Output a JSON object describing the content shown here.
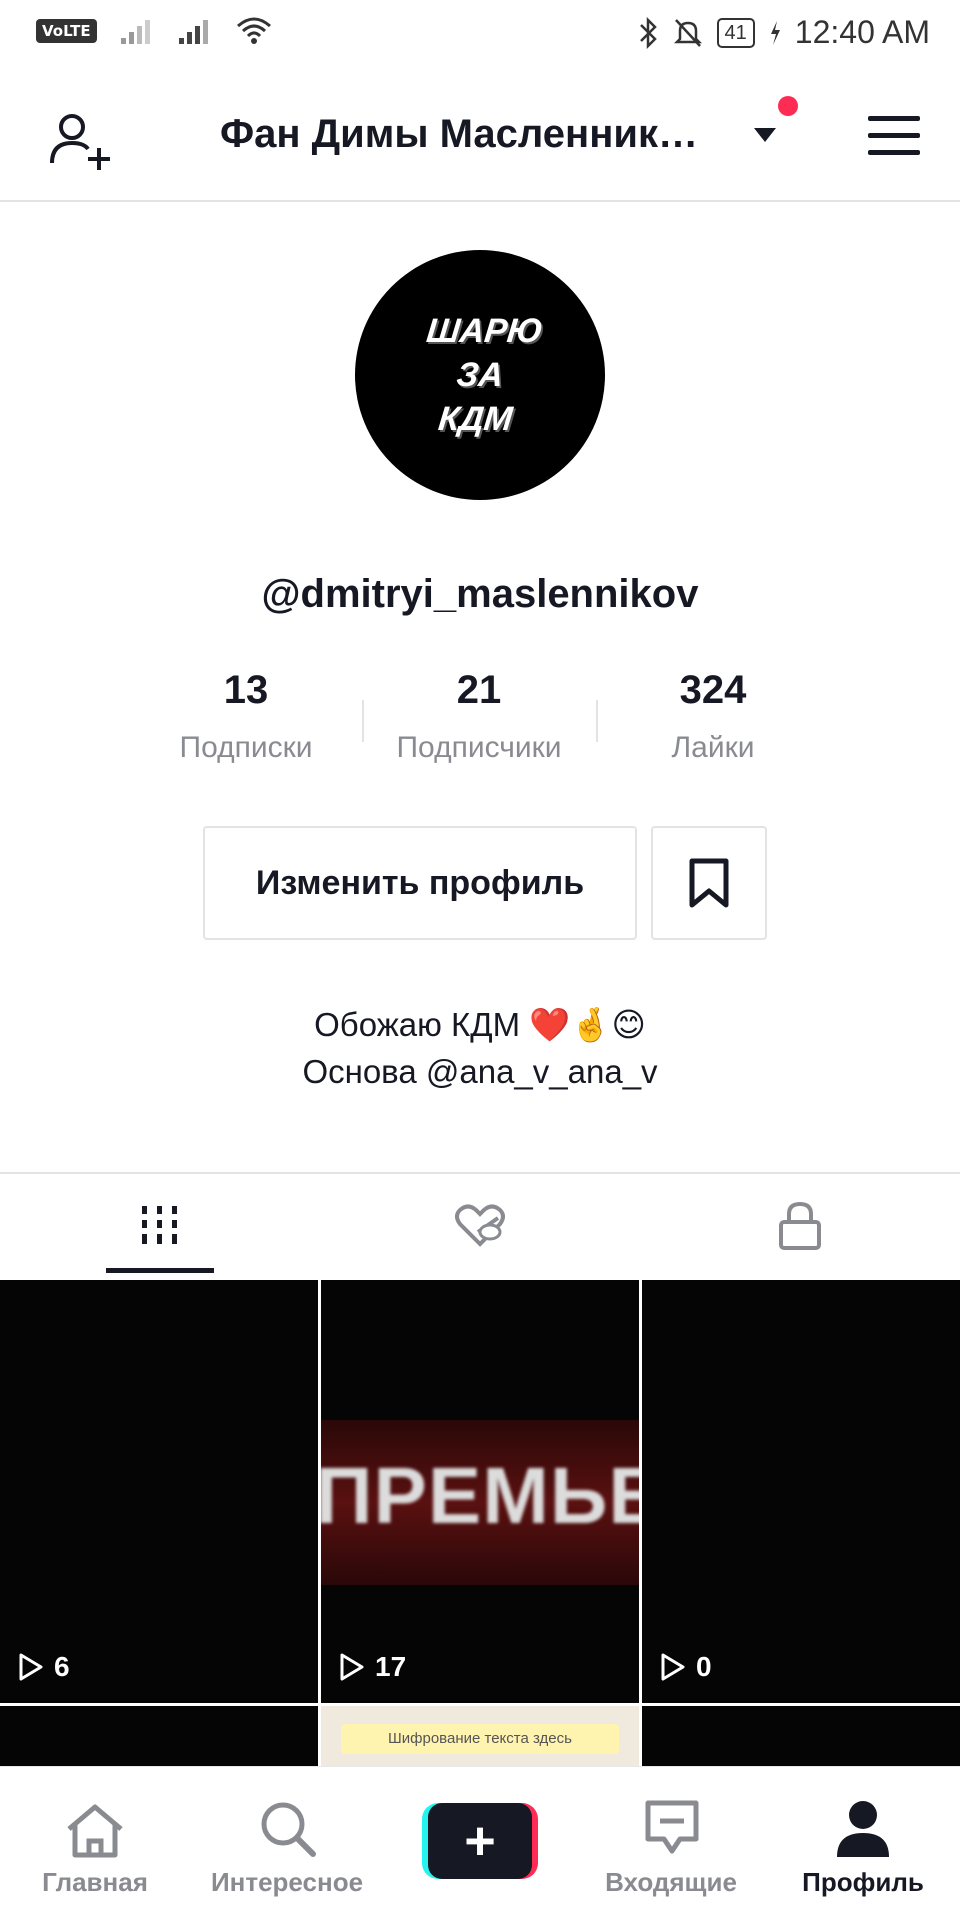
{
  "status_bar": {
    "volte": "VoLTE",
    "battery": "41",
    "time": "12:40 AM"
  },
  "header": {
    "title": "Фан Димы Масленник…"
  },
  "profile": {
    "avatar_text_line1": "ШАРЮ ЗА",
    "avatar_text_line2": "КДМ",
    "username": "@dmitryi_maslennikov",
    "stats": [
      {
        "value": "13",
        "label": "Подписки"
      },
      {
        "value": "21",
        "label": "Подписчики"
      },
      {
        "value": "324",
        "label": "Лайки"
      }
    ],
    "edit_button": "Изменить профиль",
    "bio_line1": "Обожаю КДМ ❤️🤞😊",
    "bio_line2": "Основа @ana_v_ana_v"
  },
  "tabs": [
    "videos-grid-icon",
    "liked-hidden-icon",
    "lock-icon"
  ],
  "videos": [
    {
      "views": "6"
    },
    {
      "views": "17",
      "overlay_text": "ПРЕМЬЕРА"
    },
    {
      "views": "0"
    },
    {},
    {
      "overlay_text": "Шифрование текста здесь"
    },
    {}
  ],
  "bottom_nav": {
    "home": "Главная",
    "discover": "Интересное",
    "create": "+",
    "inbox": "Входящие",
    "profile": "Профиль"
  },
  "colors": {
    "text_primary": "#161823",
    "text_secondary": "#8a8b91",
    "accent_red": "#fe2c55",
    "accent_cyan": "#25f4ee",
    "divider": "#e3e3e4"
  }
}
